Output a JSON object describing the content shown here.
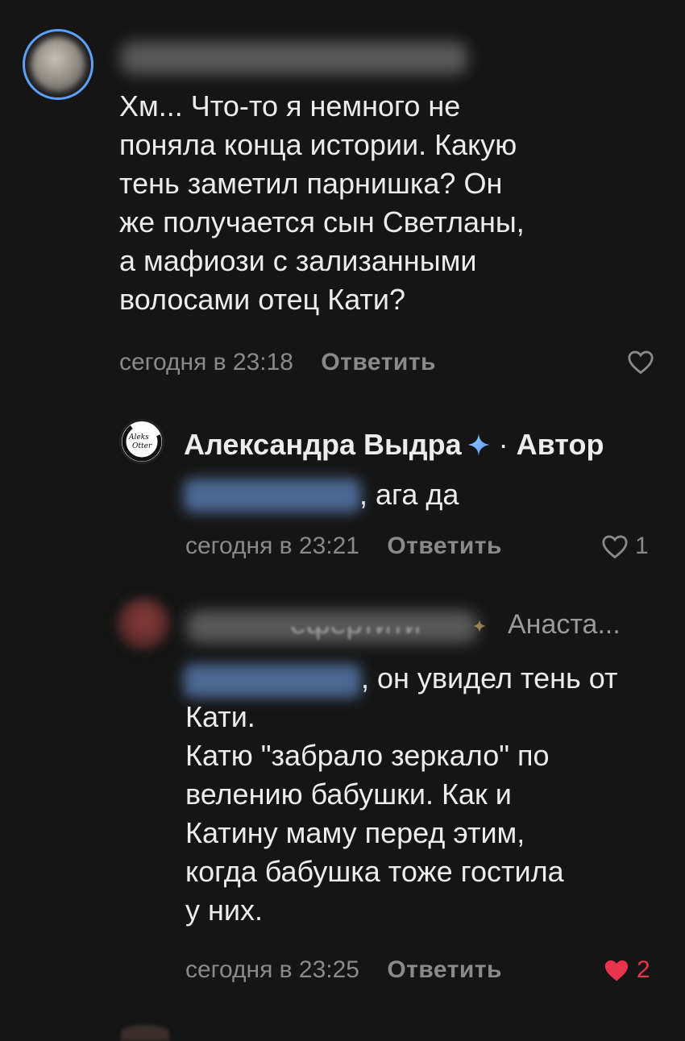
{
  "comments": [
    {
      "text": "Хм... Что-то я немного не\nпоняла конца истории. Какую\nтень заметил парнишка? Он\nже получается сын Светланы,\nа мафиози с зализанными\nволосами отец Кати?",
      "time": "сегодня в 23:18",
      "reply_label": "Ответить",
      "likes": ""
    }
  ],
  "author_reply": {
    "logo_text_top": "Aleks",
    "logo_text_bottom": "Otter",
    "name": "Александра Выдра",
    "badge_separator": "·",
    "badge": "Автор",
    "text": ", ага да",
    "time": "сегодня в 23:21",
    "reply_label": "Ответить",
    "likes": "1"
  },
  "third_reply": {
    "name_visible_part": "ефертити",
    "reply_to": "Анаста...",
    "text": ", он увидел тень от\nКати.\nКатю \"забрало зеркало\" по\nвелению бабушки. Как и\nКатину маму перед этим,\nкогда бабушка тоже гостила\nу них.",
    "time": "сегодня в 23:25",
    "reply_label": "Ответить",
    "likes": "2"
  },
  "colors": {
    "background": "#151515",
    "text": "#ececec",
    "meta": "#8a8a8a",
    "like_red": "#e8344c",
    "avatar_ring": "#5fa0ff"
  }
}
